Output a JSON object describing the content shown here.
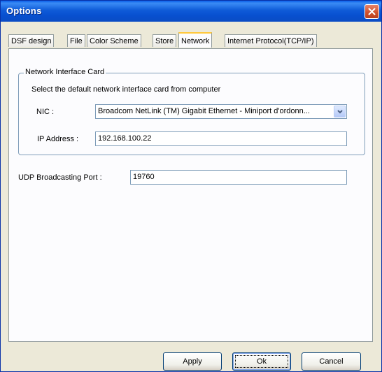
{
  "window": {
    "title": "Options"
  },
  "tabs": [
    {
      "label": "DSF design"
    },
    {
      "label": "File"
    },
    {
      "label": "Color Scheme"
    },
    {
      "label": "Store"
    },
    {
      "label": "Network",
      "active": true
    },
    {
      "label": "Internet Protocol(TCP/IP)"
    }
  ],
  "network": {
    "group_label": "Network Interface Card",
    "hint": "Select the default network interface card from computer",
    "nic_label": "NIC :",
    "nic_value": "Broadcom NetLink (TM) Gigabit Ethernet - Miniport d'ordonn...",
    "ip_label": "IP Address :",
    "ip_value": "192.168.100.22",
    "udp_label": "UDP Broadcasting Port :",
    "udp_value": "19760"
  },
  "buttons": {
    "apply": "Apply",
    "ok": "Ok",
    "cancel": "Cancel"
  },
  "colors": {
    "title_bar": "#0a5ee8",
    "close": "#d0502a",
    "active_tab": "#ffc83c",
    "dialog_bg": "#ece9d8"
  }
}
